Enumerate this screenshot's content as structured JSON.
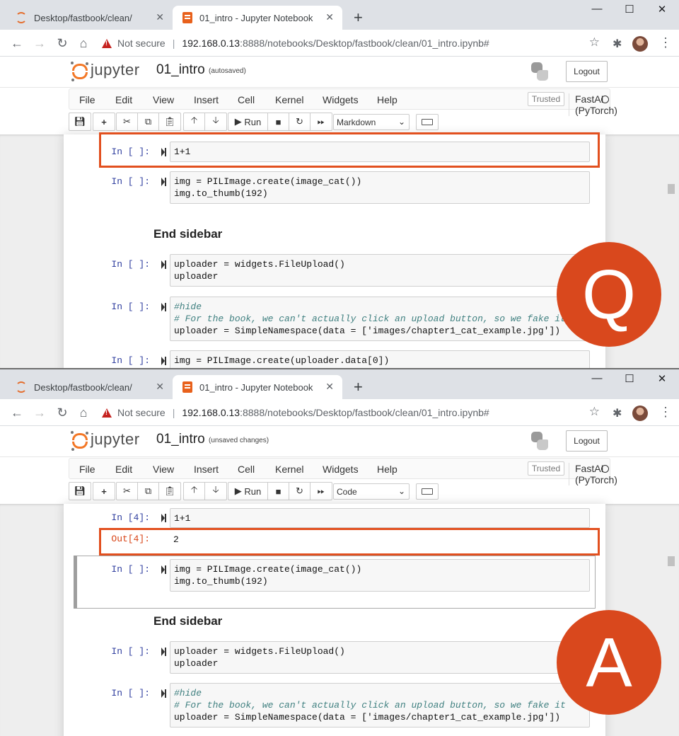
{
  "browser": {
    "tab_inactive_title": "Desktop/fastbook/clean/",
    "tab_active_title": "01_intro - Jupyter Notebook",
    "new_tab_label": "+",
    "close_label": "✕",
    "minimize_label": "—",
    "maximize_label": "☐",
    "not_secure": "Not secure",
    "url_host": "192.168.0.13",
    "url_rest": ":8888/notebooks/Desktop/fastbook/clean/01_intro.ipynb#"
  },
  "jupyter": {
    "logo_text": "jupyter",
    "notebook_name": "01_intro",
    "logout": "Logout",
    "menu": [
      "File",
      "Edit",
      "View",
      "Insert",
      "Cell",
      "Kernel",
      "Widgets",
      "Help"
    ],
    "trusted": "Trusted",
    "kernel": "FastAI (PyTorch)",
    "run_label": "Run"
  },
  "question_panel": {
    "badge": "Q",
    "save_status": "(autosaved)",
    "cell_type": "Markdown",
    "cells": [
      {
        "prompt": "In [ ]:",
        "lines": [
          "1+1"
        ]
      },
      {
        "prompt": "In [ ]:",
        "lines": [
          "img = PILImage.create(image_cat())",
          "img.to_thumb(192)"
        ]
      },
      {
        "heading": "End sidebar"
      },
      {
        "prompt": "In [ ]:",
        "lines": [
          "uploader = widgets.FileUpload()",
          "uploader"
        ]
      },
      {
        "prompt": "In [ ]:",
        "lines": [
          "#hide",
          "# For the book, we can't actually click an upload button, so we fake it",
          "uploader = SimpleNamespace(data = ['images/chapter1_cat_example.jpg'])"
        ]
      },
      {
        "prompt": "In [ ]:",
        "lines": [
          "img = PILImage.create(uploader.data[0])"
        ]
      }
    ]
  },
  "answer_panel": {
    "badge": "A",
    "save_status": "(unsaved changes)",
    "cell_type": "Code",
    "cells": [
      {
        "prompt": "In [4]:",
        "lines": [
          "1+1"
        ]
      },
      {
        "prompt": "Out[4]:",
        "output": "2"
      },
      {
        "prompt": "In [ ]:",
        "lines": [
          "img = PILImage.create(image_cat())",
          "img.to_thumb(192)"
        ]
      },
      {
        "heading": "End sidebar"
      },
      {
        "prompt": "In [ ]:",
        "lines": [
          "uploader = widgets.FileUpload()",
          "uploader"
        ]
      },
      {
        "prompt": "In [ ]:",
        "lines": [
          "#hide",
          "# For the book, we can't actually click an upload button, so we fake it",
          "uploader = SimpleNamespace(data = ['images/chapter1_cat_example.jpg'])"
        ]
      }
    ]
  },
  "colors": {
    "highlight": "#e2501f",
    "badge": "#d9481d",
    "jupyter_orange": "#f37726",
    "prompt_in": "#303f9f",
    "prompt_out": "#d84315"
  }
}
